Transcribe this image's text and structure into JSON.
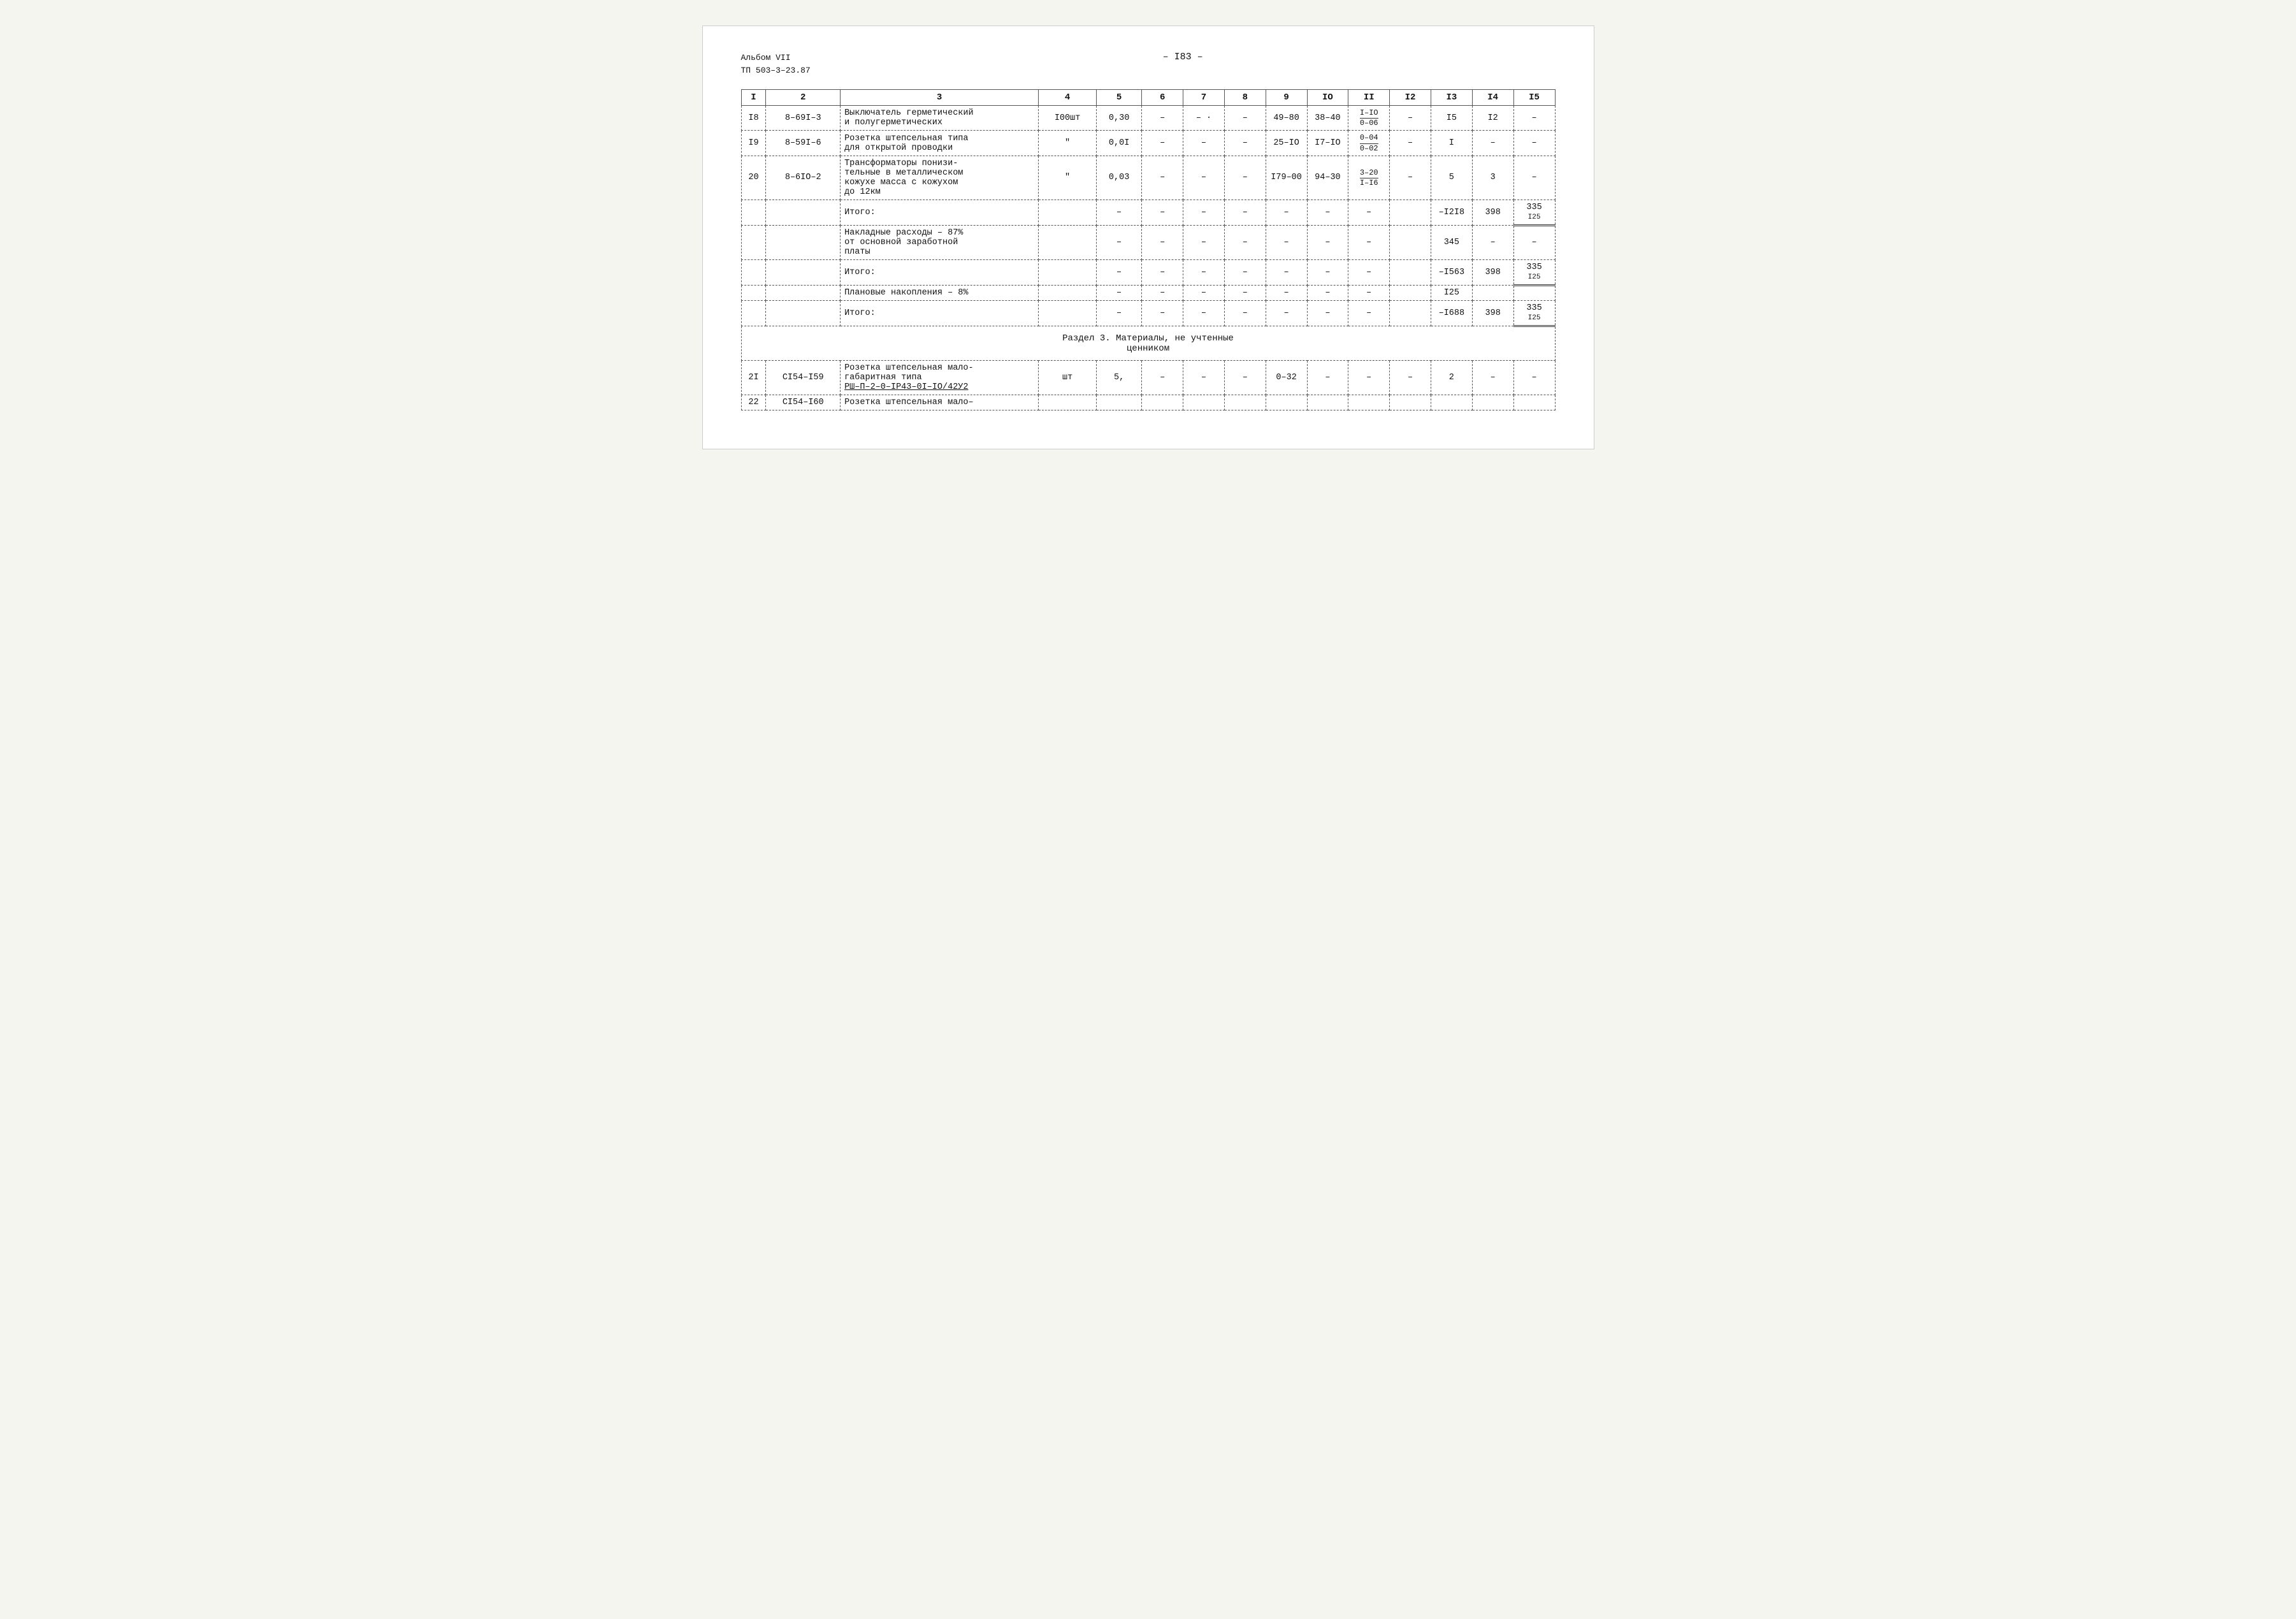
{
  "header": {
    "left_line1": "Альбом VII",
    "left_line2": "ТП 503–3–23.87",
    "center": "– I83 –",
    "right": ""
  },
  "table": {
    "columns": [
      "1",
      "2",
      "3",
      "4",
      "5",
      "6",
      "7",
      "8",
      "9",
      "IO",
      "II",
      "I2",
      "I3",
      "I4",
      "I5"
    ],
    "rows": [
      {
        "type": "data",
        "num": "I8",
        "code": "8–69I–3",
        "desc": "Выключатель герметический\nи полугерметических",
        "unit": "I00шт",
        "col5": "0,30",
        "col6": "–",
        "col7": "–",
        "col8": "–",
        "col9": "49–80",
        "col10": "38–40",
        "col11_frac": {
          "top": "I–IO",
          "bot": "0–06"
        },
        "col12": "–",
        "col13": "I5",
        "col14": "I2",
        "col15": "–"
      },
      {
        "type": "data",
        "num": "I9",
        "code": "8–59I–6",
        "desc": "Розетка штепсельная типа\nдля открытой проводки",
        "unit": "\"",
        "col5": "0,0I",
        "col6": "–",
        "col7": "–",
        "col8": "–",
        "col9": "25–IO",
        "col10": "I7–IO",
        "col11_frac": {
          "top": "0–04",
          "bot": "0–02"
        },
        "col12": "–",
        "col13": "I",
        "col14": "–",
        "col15": "–"
      },
      {
        "type": "data",
        "num": "20",
        "code": "8–6IO–2",
        "desc": "Трансформаторы понизи-\nтельные в металлическом\nкожухе масса с кожухом\nдо 12км",
        "unit": "\"",
        "col5": "0,03",
        "col6": "–",
        "col7": "–",
        "col8": "–",
        "col9": "I79–00",
        "col10": "94–30",
        "col11_frac": {
          "top": "3–20",
          "bot": "I–I6"
        },
        "col12": "–",
        "col13": "5",
        "col14": "3",
        "col15": "–"
      },
      {
        "type": "subtotal",
        "label": "Итого:",
        "col11": "–",
        "col13": "–I2I8",
        "col14": "398",
        "col15": "335",
        "col15b": "I25"
      },
      {
        "type": "overhead",
        "label": "Накладные расходы – 87%\nот основной заработной\nплаты",
        "col13": "–",
        "col14": "345",
        "col15": "–",
        "col15b": "–"
      },
      {
        "type": "subtotal",
        "label": "Итого:",
        "col11": "–",
        "col13": "–I563",
        "col14": "398",
        "col15": "335",
        "col15b": "I25"
      },
      {
        "type": "planned",
        "label": "Плановые накопления – 8%",
        "col13": "–",
        "col14": "–",
        "col15": "I25",
        "col15b": ""
      },
      {
        "type": "subtotal",
        "label": "Итого:",
        "col11": "–",
        "col13": "–I688",
        "col14": "398",
        "col15": "335",
        "col15b": "I25"
      },
      {
        "type": "section_header",
        "label": "Раздел 3. Материалы, не учтенные\nценником"
      },
      {
        "type": "data",
        "num": "2I",
        "code": "CI54–I59",
        "desc": "Розетка штепсельная мало-\nгабаритная типа\nРШ–П–2–0–IР43–0I–IO/42У2",
        "unit": "шт",
        "col5": "5,",
        "col6": "–",
        "col7": "–",
        "col8": "–",
        "col9": "0–32",
        "col10": "–",
        "col11": "–",
        "col12": "–",
        "col13": "2",
        "col14": "–",
        "col15": "–"
      },
      {
        "type": "data_partial",
        "num": "22",
        "code": "CI54–I60",
        "desc": "Розетка штепсельная мало–"
      }
    ]
  }
}
